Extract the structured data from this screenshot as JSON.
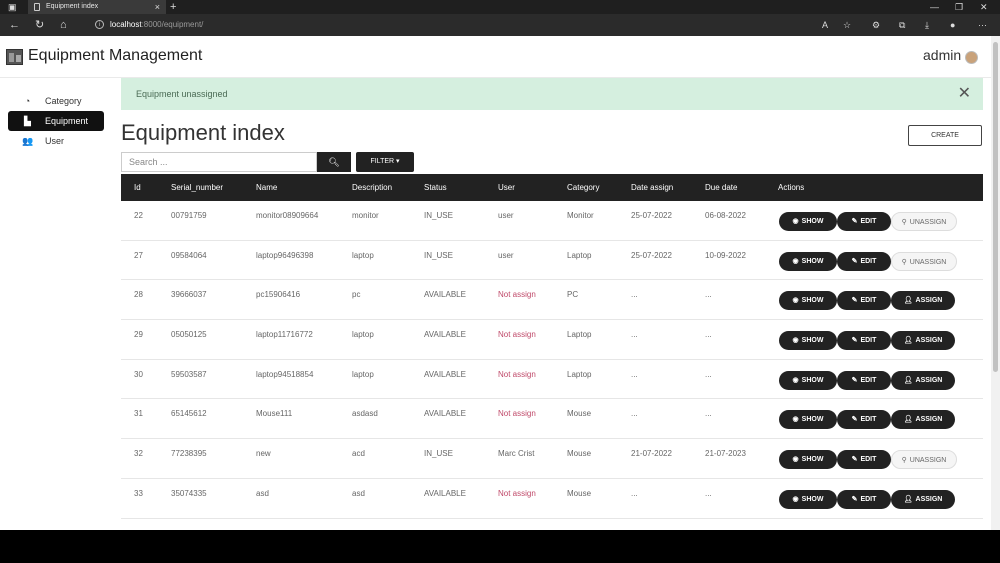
{
  "browser": {
    "tab_title": "Equipment index",
    "url_host": "localhost",
    "url_path": ":8000/equipment/"
  },
  "app": {
    "title": "Equipment Management",
    "user": "admin"
  },
  "sidebar": {
    "items": [
      {
        "label": "Category",
        "icon": "dashboard-icon",
        "active": false
      },
      {
        "label": "Equipment",
        "icon": "chart-icon",
        "active": true
      },
      {
        "label": "User",
        "icon": "users-icon",
        "active": false
      }
    ]
  },
  "alert": {
    "message": "Equipment unassigned"
  },
  "page": {
    "heading": "Equipment index",
    "create_label": "CREATE",
    "search_placeholder": "Search ...",
    "filter_label": "FILTER ▾"
  },
  "table": {
    "headers": [
      "Id",
      "Serial_number",
      "Name",
      "Description",
      "Status",
      "User",
      "Category",
      "Date assign",
      "Due date",
      "Actions"
    ],
    "buttons": {
      "show": "SHOW",
      "edit": "EDIT",
      "assign": "ASSIGN",
      "unassign": "UNASSIGN"
    },
    "rows": [
      {
        "id": "22",
        "serial": "00791759",
        "name": "monitor08909664",
        "description": "monitor",
        "status": "IN_USE",
        "user": "user",
        "category": "Monitor",
        "date_assign": "25-07-2022",
        "due_date": "06-08-2022",
        "action": "unassign"
      },
      {
        "id": "27",
        "serial": "09584064",
        "name": "laptop96496398",
        "description": "laptop",
        "status": "IN_USE",
        "user": "user",
        "category": "Laptop",
        "date_assign": "25-07-2022",
        "due_date": "10-09-2022",
        "action": "unassign"
      },
      {
        "id": "28",
        "serial": "39666037",
        "name": "pc15906416",
        "description": "pc",
        "status": "AVAILABLE",
        "user": "Not assign",
        "category": "PC",
        "date_assign": "...",
        "due_date": "...",
        "action": "assign"
      },
      {
        "id": "29",
        "serial": "05050125",
        "name": "laptop11716772",
        "description": "laptop",
        "status": "AVAILABLE",
        "user": "Not assign",
        "category": "Laptop",
        "date_assign": "...",
        "due_date": "...",
        "action": "assign"
      },
      {
        "id": "30",
        "serial": "59503587",
        "name": "laptop94518854",
        "description": "laptop",
        "status": "AVAILABLE",
        "user": "Not assign",
        "category": "Laptop",
        "date_assign": "...",
        "due_date": "...",
        "action": "assign"
      },
      {
        "id": "31",
        "serial": "65145612",
        "name": "Mouse111",
        "description": "asdasd",
        "status": "AVAILABLE",
        "user": "Not assign",
        "category": "Mouse",
        "date_assign": "...",
        "due_date": "...",
        "action": "assign"
      },
      {
        "id": "32",
        "serial": "77238395",
        "name": "new",
        "description": "acd",
        "status": "IN_USE",
        "user": "Marc Crist",
        "category": "Mouse",
        "date_assign": "21-07-2022",
        "due_date": "21-07-2023",
        "action": "unassign"
      },
      {
        "id": "33",
        "serial": "35074335",
        "name": "asd",
        "description": "asd",
        "status": "AVAILABLE",
        "user": "Not assign",
        "category": "Mouse",
        "date_assign": "...",
        "due_date": "...",
        "action": "assign"
      }
    ]
  }
}
